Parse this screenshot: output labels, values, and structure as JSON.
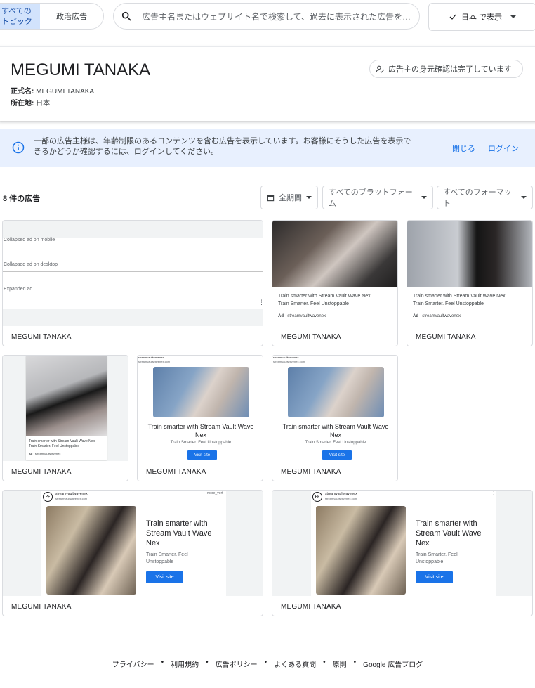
{
  "topbar": {
    "topic_all": "すべての トピック",
    "topic_political": "政治広告",
    "search_placeholder": "広告主名またはウェブサイト名で検索して、過去に表示された広告を…",
    "region_button": "日本 で表示"
  },
  "advertiser": {
    "name": "MEGUMI TANAKA",
    "legal_label": "正式名:",
    "legal_value": "MEGUMI TANAKA",
    "location_label": "所在地:",
    "location_value": "日本",
    "verified_label": "広告主の身元確認は完了しています"
  },
  "banner": {
    "text": "一部の広告主様は、年齢制限のあるコンテンツを含む広告を表示しています。お客様にそうした広告を表示できるかどうか確認するには、ログインしてください。",
    "close": "閉じる",
    "login": "ログイン"
  },
  "filters": {
    "count": "8 件の広告",
    "date": "全期間",
    "platform": "すべてのプラットフォーム",
    "format": "すべてのフォーマット"
  },
  "ads": {
    "card1": {
      "row1": "Collapsed ad on mobile",
      "row2": "Collapsed ad on desktop",
      "row3": "Expanded ad",
      "advertiser": "MEGUMI TANAKA"
    },
    "card2": {
      "line1": "Train smarter with Stream Vault Wave Nex.",
      "line2": "Train Smarter. Feel Unstoppable",
      "ad_label": "Ad",
      "domain": "streamvaultwavenex",
      "advertiser": "MEGUMI TANAKA"
    },
    "card3": {
      "line1": "Train smarter with Stream Vault Wave Nex.",
      "line2": "Train Smarter. Feel Unstoppable",
      "ad_label": "Ad",
      "domain": "streamvaultwavenex",
      "advertiser": "MEGUMI TANAKA"
    },
    "card4": {
      "line1": "Train smarter with Stream Vault Wave Nex.",
      "line2": "Train Smarter. Feel Unstoppable",
      "ad_label": "Ad",
      "domain": "streamvaultwavenex",
      "advertiser": "MEGUMI TANAKA"
    },
    "card5": {
      "site": "streamvaultwavenex",
      "url": "streamvaultwavenex.com",
      "headline": "Train smarter with Stream Vault Wave Nex",
      "desc": "Train Smarter. Feel Unstoppable",
      "cta": "Visit site",
      "advertiser": "MEGUMI TANAKA"
    },
    "card6": {
      "site": "streamvaultwavenex",
      "url": "streamvaultwavenex.com",
      "headline": "Train smarter with Stream Vault Wave Nex",
      "desc": "Train Smarter. Feel Unstoppable",
      "cta": "Visit site",
      "advertiser": "MEGUMI TANAKA"
    },
    "card7": {
      "logo": "PF",
      "site": "streamvaultwavenex",
      "url": "streamvaultwavenex.com",
      "corner": "more_vert",
      "headline": "Train smarter with Stream Vault Wave Nex",
      "desc": "Train Smarter. Feel Unstoppable",
      "cta": "Visit site",
      "advertiser": "MEGUMI TANAKA"
    },
    "card8": {
      "logo": "PF",
      "site": "streamvaultwavenex",
      "url": "streamvaultwavenex.com",
      "headline": "Train smarter with Stream Vault Wave Nex",
      "desc": "Train Smarter. Feel Unstoppable",
      "cta": "Visit site",
      "advertiser": "MEGUMI TANAKA"
    }
  },
  "footer": {
    "privacy": "プライバシー",
    "terms": "利用規約",
    "ad_policy": "広告ポリシー",
    "faq": "よくある質問",
    "principles": "原則",
    "blog": "Google 広告ブログ"
  },
  "colors": {
    "accent": "#1a73e8",
    "banner_bg": "#e8f0fe",
    "topic_selected_bg": "#d2e3fc"
  },
  "icons": [
    "search-icon",
    "checkmark-icon",
    "chevron-down-icon",
    "verified-person-icon",
    "info-icon",
    "calendar-icon",
    "more-vert-icon"
  ]
}
